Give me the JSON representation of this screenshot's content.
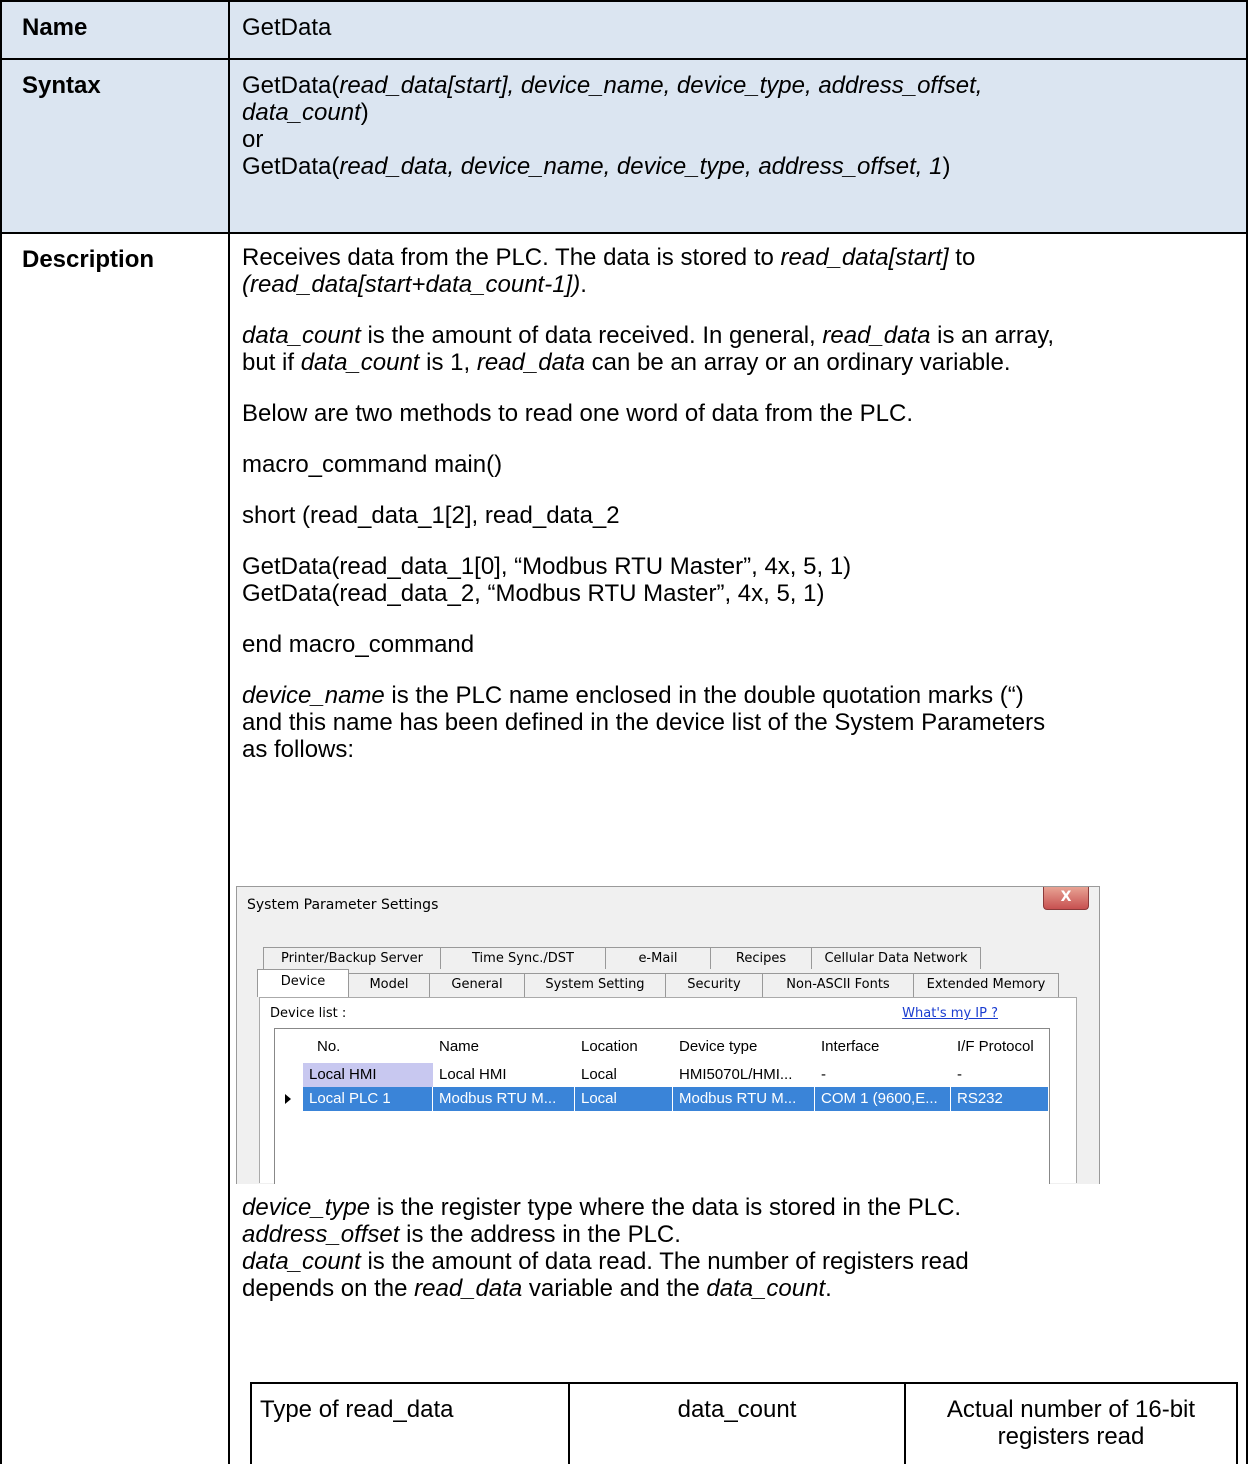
{
  "name_row": {
    "label": "Name",
    "value": "GetData"
  },
  "syntax_row": {
    "label": "Syntax",
    "line1_pre": "GetData(",
    "line1_args": "read_data[start], device_name, device_type, address_offset,",
    "line2_args": "data_count",
    "line2_post": ")",
    "or_text": "or",
    "line3_pre": "GetData(",
    "line3_args": "read_data, device_name, device_type, address_offset, 1",
    "line3_post": ")"
  },
  "description_row": {
    "label": "Description",
    "p1": {
      "a": "Receives data from the PLC. The data is stored to ",
      "b": "read_data[start]",
      "c": " to",
      "d": "(read_data[start+data_count-1])",
      "e": "."
    },
    "p2": {
      "a": "data_count",
      "b": " is the amount of data received. In general, ",
      "c": "read_data",
      "d": " is an array,",
      "e": "but if ",
      "f": "data_count",
      "g": " is 1, ",
      "h": "read_data",
      "i": " can be an array or an ordinary variable."
    },
    "p3": "Below are two methods to read one word of data from the PLC.",
    "code1": "macro_command main()",
    "code2": "short (read_data_1[2], read_data_2",
    "code3": "GetData(read_data_1[0], “Modbus RTU Master”, 4x, 5, 1)",
    "code4": "GetData(read_data_2, “Modbus RTU Master”, 4x, 5, 1)",
    "code5": "end macro_command",
    "p4": {
      "a": "device_name",
      "b": " is the PLC name enclosed in the double quotation marks (“)",
      "c": "and this name has been defined in the device list of the System Parameters",
      "d": "as follows:"
    },
    "p5": {
      "a": "device_type",
      "b": " is the register type where the data is stored in the PLC."
    },
    "p6": {
      "a": "address_offset",
      "b": " is the address in the PLC."
    },
    "p7": {
      "a": "data_count",
      "b": " is the amount of data read. The number of registers read",
      "c": "depends on the ",
      "d": "read_data",
      "e": " variable and the ",
      "f": "data_count",
      "g": "."
    }
  },
  "dialog": {
    "title": "System Parameter Settings",
    "close_label": "X",
    "tabs_back": [
      "Printer/Backup Server",
      "Time Sync./DST",
      "e-Mail",
      "Recipes",
      "Cellular Data Network"
    ],
    "tabs_front": [
      "Device",
      "Model",
      "General",
      "System Setting",
      "Security",
      "Non-ASCII Fonts",
      "Extended Memory"
    ],
    "device_list_label": "Device list :",
    "whats_my_ip": "What's my IP ?",
    "columns": [
      "No.",
      "Name",
      "Location",
      "Device type",
      "Interface",
      "I/F Protocol"
    ],
    "rows": [
      [
        "Local HMI",
        "Local HMI",
        "Local",
        "HMI5070L/HMI...",
        "-",
        "-"
      ],
      [
        "Local PLC 1",
        "Modbus RTU M...",
        "Local",
        "Modbus RTU M...",
        "COM 1 (9600,E...",
        "RS232"
      ]
    ]
  },
  "count_table": {
    "headers": [
      "Type of read_data",
      "data_count",
      "Actual number of 16-bit",
      "registers read"
    ]
  }
}
